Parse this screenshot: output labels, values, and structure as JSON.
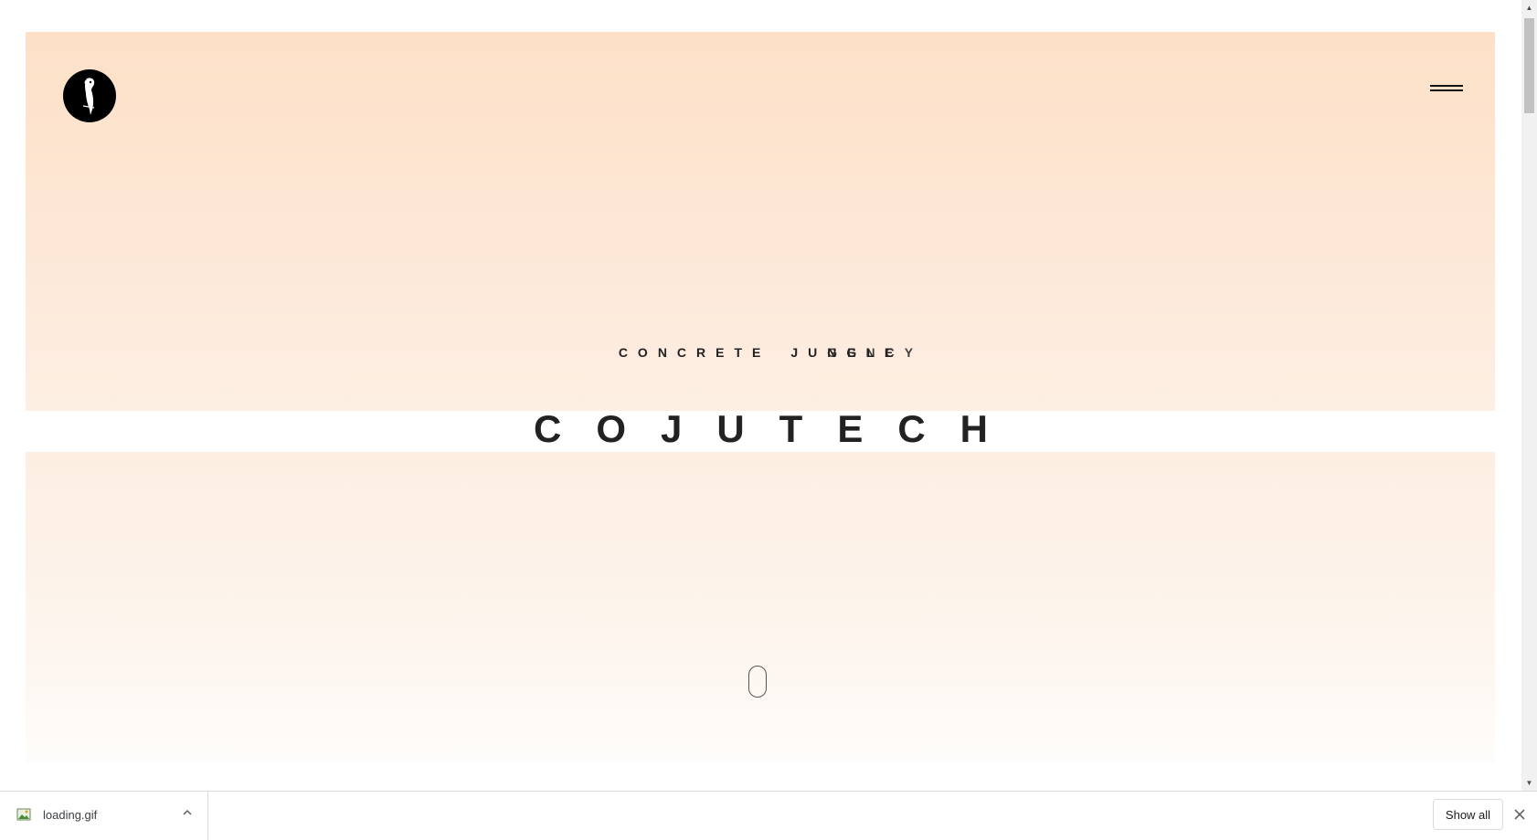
{
  "hero": {
    "tagline_word_1": "CONCRETE",
    "tagline_word_2_prefix": "JU",
    "tagline_word_2_layer_a": "NGLE",
    "tagline_word_2_layer_b": "GENCY",
    "tagline_overlap_note": "",
    "brand": "COJUTECH",
    "colors": {
      "gradient_top": "#fde0c7",
      "gradient_bottom": "#fefcfa",
      "text": "#222222"
    }
  },
  "header": {
    "logo_icon": "parrot-logo-icon",
    "menu_icon": "hamburger-menu-icon"
  },
  "downloads": {
    "file_name": "loading.gif",
    "show_all_label": "Show all",
    "file_icon": "image-file-icon",
    "expand_icon": "chevron-up-icon",
    "close_icon": "close-icon"
  }
}
